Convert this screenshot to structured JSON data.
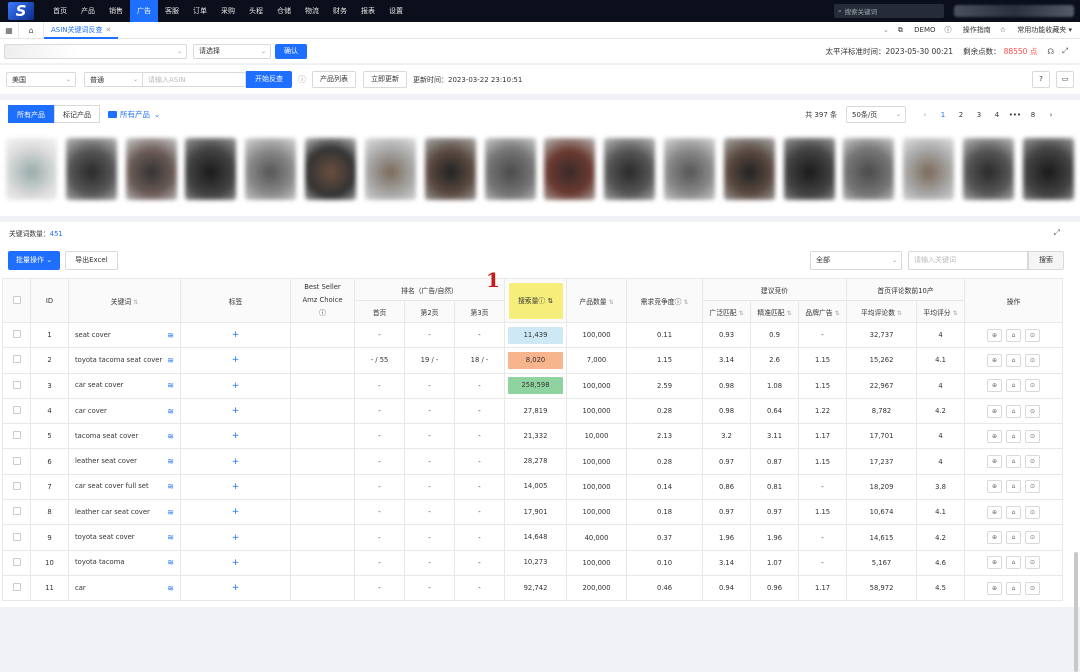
{
  "nav": {
    "logo": "S",
    "items": [
      "首页",
      "产品",
      "销售",
      "广告",
      "客服",
      "订单",
      "采购",
      "头程",
      "仓储",
      "物流",
      "财务",
      "报表",
      "设置"
    ],
    "active_index": 3,
    "search_placeholder": "搜索关键词"
  },
  "tabs": {
    "active": "ASIN关键词反查",
    "right_items": [
      "DEMO",
      "操作指南",
      "常用功能收藏夹"
    ]
  },
  "filter": {
    "select2": "请选择",
    "confirm": "确认",
    "time_label": "太平洋标准时间：2023-05-30 00:21",
    "points_label": "剩余点数：",
    "points_value": "88550 点"
  },
  "search": {
    "country": "美国",
    "mode": "普通",
    "asin_placeholder": "请输入ASIN",
    "start_btn": "开始反查",
    "product_list_btn": "产品列表",
    "update_btn": "立即更新",
    "update_time": "更新时间：2023-03-22 23:10:51"
  },
  "products": {
    "tab_all": "所有产品",
    "tab_marked": "标记产品",
    "folder_label": "所有产品",
    "total": "共 397 条",
    "per_page": "50条/页",
    "pages": [
      "1",
      "2",
      "3",
      "4",
      "•••",
      "8"
    ]
  },
  "main": {
    "kw_count_label": "关键词数量：",
    "kw_count": "451",
    "batch_btn": "批量操作",
    "export_btn": "导出Excel",
    "filter_all": "全部",
    "kw_input_placeholder": "请输入关键词",
    "search_btn": "搜索",
    "annotation": "1"
  },
  "table": {
    "headers": {
      "id": "ID",
      "keyword": "关键词",
      "tag": "标签",
      "best_seller": "Best Seller",
      "amz_choice": "Amz Choice",
      "rank_group": "排名（广告/自然）",
      "rank_p1": "首页",
      "rank_p2": "第2页",
      "rank_p3": "第3页",
      "search_volume": "搜索量",
      "product_count": "产品数量",
      "competition": "需求竞争度",
      "bid_group": "建议竞价",
      "broad": "广泛匹配",
      "exact": "精准匹配",
      "brand_ad": "品牌广告",
      "review_group": "首页评论数前10产",
      "avg_reviews": "平均评论数",
      "avg_rating": "平均评分",
      "ops": "操作"
    },
    "rows": [
      {
        "id": "1",
        "kw": "seat cover",
        "p1": "-",
        "p2": "-",
        "p3": "-",
        "sv": "11,439",
        "pc": "100,000",
        "comp": "0.11",
        "broad": "0.93",
        "exact": "0.9",
        "brand": "-",
        "reviews": "32,737",
        "rating": "4"
      },
      {
        "id": "2",
        "kw": "toyota tacoma seat cover",
        "p1": "- / 55",
        "p2": "19 / -",
        "p3": "18 / -",
        "sv": "8,020",
        "pc": "7,000",
        "comp": "1.15",
        "broad": "3.14",
        "exact": "2.6",
        "brand": "1.15",
        "reviews": "15,262",
        "rating": "4.1"
      },
      {
        "id": "3",
        "kw": "car seat cover",
        "p1": "-",
        "p2": "-",
        "p3": "-",
        "sv": "258,598",
        "pc": "100,000",
        "comp": "2.59",
        "broad": "0.98",
        "exact": "1.08",
        "brand": "1.15",
        "reviews": "22,967",
        "rating": "4"
      },
      {
        "id": "4",
        "kw": "car cover",
        "p1": "-",
        "p2": "-",
        "p3": "-",
        "sv": "27,819",
        "pc": "100,000",
        "comp": "0.28",
        "broad": "0.98",
        "exact": "0.64",
        "brand": "1.22",
        "reviews": "8,782",
        "rating": "4.2"
      },
      {
        "id": "5",
        "kw": "tacoma seat cover",
        "p1": "-",
        "p2": "-",
        "p3": "-",
        "sv": "21,332",
        "pc": "10,000",
        "comp": "2.13",
        "broad": "3.2",
        "exact": "3.11",
        "brand": "1.17",
        "reviews": "17,701",
        "rating": "4"
      },
      {
        "id": "6",
        "kw": "leather seat cover",
        "p1": "-",
        "p2": "-",
        "p3": "-",
        "sv": "28,278",
        "pc": "100,000",
        "comp": "0.28",
        "broad": "0.97",
        "exact": "0.87",
        "brand": "1.15",
        "reviews": "17,237",
        "rating": "4"
      },
      {
        "id": "7",
        "kw": "car seat cover full set",
        "p1": "-",
        "p2": "-",
        "p3": "-",
        "sv": "14,005",
        "pc": "100,000",
        "comp": "0.14",
        "broad": "0.86",
        "exact": "0.81",
        "brand": "-",
        "reviews": "18,209",
        "rating": "3.8"
      },
      {
        "id": "8",
        "kw": "leather car seat cover",
        "p1": "-",
        "p2": "-",
        "p3": "-",
        "sv": "17,901",
        "pc": "100,000",
        "comp": "0.18",
        "broad": "0.97",
        "exact": "0.97",
        "brand": "1.15",
        "reviews": "10,674",
        "rating": "4.1"
      },
      {
        "id": "9",
        "kw": "toyota seat cover",
        "p1": "-",
        "p2": "-",
        "p3": "-",
        "sv": "14,648",
        "pc": "40,000",
        "comp": "0.37",
        "broad": "1.96",
        "exact": "1.96",
        "brand": "-",
        "reviews": "14,615",
        "rating": "4.2"
      },
      {
        "id": "10",
        "kw": "toyota tacoma",
        "p1": "-",
        "p2": "-",
        "p3": "-",
        "sv": "10,273",
        "pc": "100,000",
        "comp": "0.10",
        "broad": "3.14",
        "exact": "1.07",
        "brand": "-",
        "reviews": "5,167",
        "rating": "4.6"
      },
      {
        "id": "11",
        "kw": "car",
        "p1": "-",
        "p2": "-",
        "p3": "-",
        "sv": "92,742",
        "pc": "200,000",
        "comp": "0.46",
        "broad": "0.94",
        "exact": "0.96",
        "brand": "1.17",
        "reviews": "58,972",
        "rating": "4.5"
      }
    ],
    "sv_highlights": [
      "#cfe8f5",
      "#f8b48c",
      "#8fd4a0"
    ],
    "sv_header_color": "#f5ee7a"
  }
}
